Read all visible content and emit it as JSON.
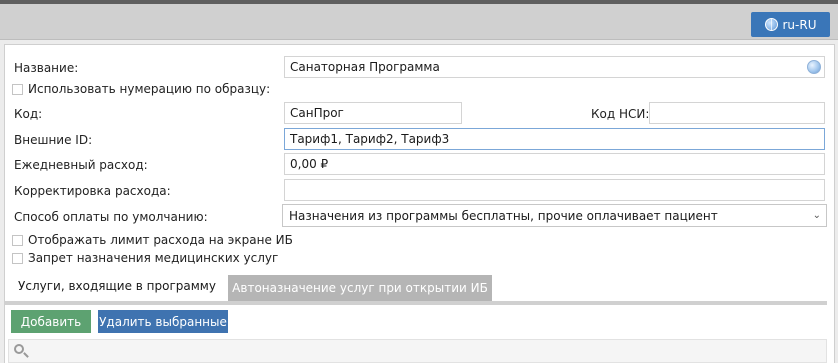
{
  "header": {
    "language_label": "ru-RU"
  },
  "form": {
    "name_label": "Название:",
    "name_value": "Санаторная Программа",
    "use_numbering_label": "Использовать нумерацию по образцу:",
    "code_label": "Код:",
    "code_value": "СанПрог",
    "nsi_code_label": "Код НСИ:",
    "nsi_code_value": "",
    "external_id_label": "Внешние ID:",
    "external_id_value": "Тариф1, Тариф2, Тариф3",
    "daily_expense_label": "Ежедневный расход:",
    "daily_expense_value": "0,00 ₽",
    "expense_adjustment_label": "Корректировка расхода:",
    "expense_adjustment_value": "",
    "payment_method_label": "Способ оплаты по умолчанию:",
    "payment_method_value": "Назначения из программы бесплатны, прочие оплачивает пациент",
    "show_limit_label": "Отображать лимит расхода на экране ИБ",
    "ban_services_label": "Запрет назначения медицинских услуг"
  },
  "tabs": [
    {
      "label": "Услуги, входящие в программу"
    },
    {
      "label": "Автоназначение услуг при открытии ИБ"
    }
  ],
  "actions": {
    "add_label": "Добавить",
    "delete_selected_label": "Удалить выбранные"
  },
  "colors": {
    "accent_blue": "#3a76b8",
    "add_green": "#5da271",
    "delete_blue": "#3f73b0"
  }
}
